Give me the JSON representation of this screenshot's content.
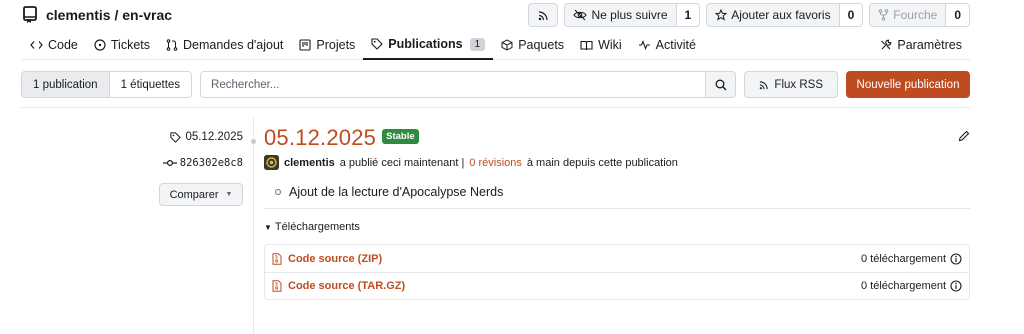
{
  "header": {
    "repo_name": "clementis / en-vrac",
    "unwatch_label": "Ne plus suivre",
    "watch_count": "1",
    "star_label": "Ajouter aux favoris",
    "star_count": "0",
    "fork_label": "Fourche",
    "fork_count": "0"
  },
  "tabs": [
    {
      "label": "Code",
      "icon": "code-icon"
    },
    {
      "label": "Tickets",
      "icon": "issue-icon"
    },
    {
      "label": "Demandes d'ajout",
      "icon": "pull-request-icon"
    },
    {
      "label": "Projets",
      "icon": "project-icon"
    },
    {
      "label": "Publications",
      "icon": "tag-icon",
      "badge": "1",
      "active": true
    },
    {
      "label": "Paquets",
      "icon": "package-icon"
    },
    {
      "label": "Wiki",
      "icon": "book-icon"
    },
    {
      "label": "Activité",
      "icon": "pulse-icon"
    },
    {
      "label": "Paramètres",
      "icon": "tools-icon"
    }
  ],
  "toolbar": {
    "publications_label": "1 publication",
    "tags_label": "1 étiquettes",
    "search_placeholder": "Rechercher...",
    "rss_label": "Flux RSS",
    "new_release_label": "Nouvelle publication"
  },
  "release": {
    "tag": "05.12.2025",
    "commit": "826302e8c8",
    "compare_label": "Comparer",
    "title": "05.12.2025",
    "status_badge": "Stable",
    "author": "clementis",
    "published_text": "a publié ceci maintenant |",
    "revisions_link": "0 révisions",
    "revisions_suffix": "à main depuis cette publication",
    "notes": [
      "Ajout de la lecture d'Apocalypse Nerds"
    ],
    "downloads_label": "Téléchargements",
    "assets": [
      {
        "name": "Code source (ZIP)",
        "count": "0 téléchargement"
      },
      {
        "name": "Code source (TAR.GZ)",
        "count": "0 téléchargement"
      }
    ]
  },
  "colors": {
    "accent": "#be4c20",
    "stable": "#2e8b3f"
  }
}
